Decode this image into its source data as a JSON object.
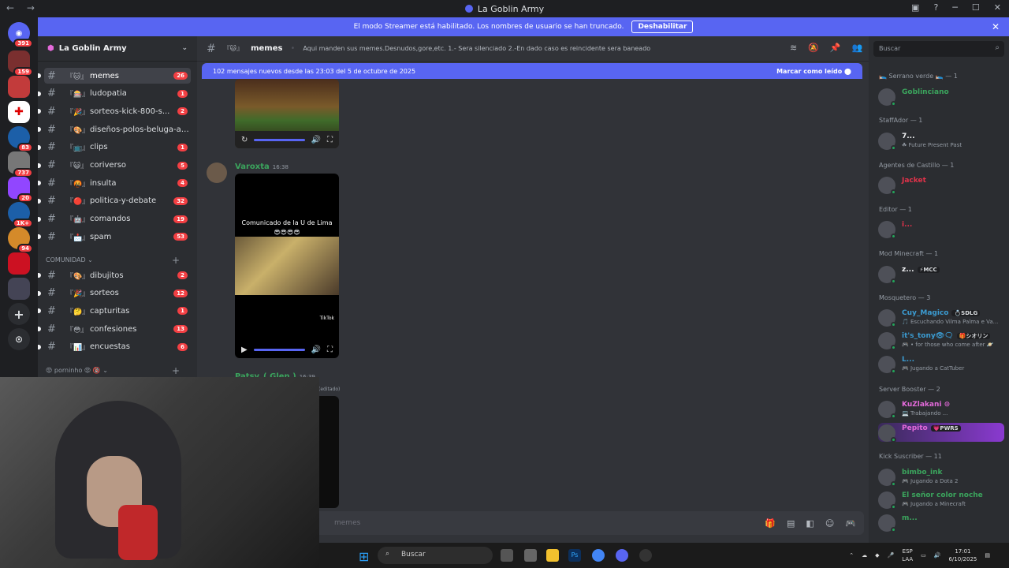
{
  "window": {
    "title": "La Goblin Army",
    "nav_back": "←",
    "nav_fwd": "→"
  },
  "guilds": [
    {
      "label": "391",
      "color": "#e3324a"
    },
    {
      "label": "159",
      "color": "#7a2f2f"
    },
    {
      "label": "",
      "color": "#d44"
    },
    {
      "label": "",
      "color": "#ff3b3b"
    },
    {
      "label": "83",
      "color": "#1c5fa8"
    },
    {
      "label": "737",
      "color": "#777"
    },
    {
      "label": "20",
      "color": "#9146ff"
    },
    {
      "label": "1K+",
      "color": "#1c5fa8"
    },
    {
      "label": "94",
      "color": "#d48a2a"
    },
    {
      "label": "",
      "color": "#c12"
    },
    {
      "label": "",
      "color": "#445"
    }
  ],
  "banner": {
    "text": "El modo Streamer está habilitado. Los nombres de usuario se han truncado.",
    "button": "Deshabilitar",
    "close": "✕"
  },
  "server": {
    "name": "La Goblin Army",
    "caret": "⌄"
  },
  "channels": [
    {
      "emoji": "『🐱』",
      "name": "memes",
      "count": "26",
      "active": true
    },
    {
      "emoji": "『🎰』",
      "name": "ludopatia",
      "count": "1"
    },
    {
      "emoji": "『🎉』",
      "name": "sorteos-kick-800-s...",
      "count": "2"
    },
    {
      "emoji": "『🎨』",
      "name": "diseños-polos-beluga-ar...",
      "count": ""
    },
    {
      "emoji": "『📺』",
      "name": "clips",
      "count": "1"
    },
    {
      "emoji": "『😺』",
      "name": "coriverso",
      "count": "5"
    },
    {
      "emoji": "『🤬』",
      "name": "insulta",
      "count": "4"
    },
    {
      "emoji": "『🔴』",
      "name": "politica-y-debate",
      "count": "32"
    },
    {
      "emoji": "『🤖』",
      "name": "comandos",
      "count": "19"
    },
    {
      "emoji": "『📩』",
      "name": "spam",
      "count": "53"
    }
  ],
  "category_comunidad": {
    "label": "COMUNIDAD",
    "plus": "+"
  },
  "channels2": [
    {
      "emoji": "『🎨』",
      "name": "dibujitos",
      "count": "2"
    },
    {
      "emoji": "『🎉』",
      "name": "sorteos",
      "count": "12"
    },
    {
      "emoji": "『🤔』",
      "name": "capturitas",
      "count": "1"
    },
    {
      "emoji": "『😳』",
      "name": "confesiones",
      "count": "13"
    },
    {
      "emoji": "『📊』",
      "name": "encuestas",
      "count": "6"
    }
  ],
  "category_porninho": {
    "label": "😡 porninho 😡 🔞",
    "plus": "+"
  },
  "chat": {
    "channel": "memes",
    "emoji": "『🐱』",
    "topic": "Aqui manden sus memes.Desnudos,gore,etc. 1.- Sera silenciado 2.-En dado caso es reincidente sera baneado",
    "new_messages": "102 mensajes nuevos desde las 23:03 del 5 de octubre de 2025",
    "mark_read": "Marcar como leído",
    "message2_author": "Varoxta",
    "message2_time": "16:38",
    "video_caption": "Comunicado de la U de Lima",
    "video_emojis": "😎😎😎😎",
    "tiktok": "TikTok",
    "message3_author": "Patsy_( Glen )",
    "message3_time": "16:39",
    "edited": "(editado)",
    "input_placeholder": "memes",
    "search_placeholder": "Buscar"
  },
  "members": {
    "groups": [
      {
        "label": "🛌 Serrano verde 🛌 — 1"
      },
      {
        "label": "StaffAdor — 1"
      },
      {
        "label": "Agentes de Castillo — 1"
      },
      {
        "label": "Editor — 1"
      },
      {
        "label": "Mod Minecraft — 1"
      },
      {
        "label": "Mosquetero — 3"
      },
      {
        "label": "Server Booster — 2"
      },
      {
        "label": "Kick Suscriber — 11"
      }
    ],
    "list": [
      {
        "name": "Goblinciano",
        "activity": "",
        "color": "#3ba55d"
      },
      {
        "name": "7...",
        "activity": "☘ Future Present Past",
        "color": "#f2f3f5"
      },
      {
        "name": "Jacket",
        "activity": "",
        "color": "#e3324a"
      },
      {
        "name": "i...",
        "activity": "",
        "color": "#e3324a"
      },
      {
        "name": "z...",
        "activity": "",
        "tag": "⚡MCC",
        "color": "#f2f3f5"
      },
      {
        "name": "Cuy_Magico",
        "activity": "🎵 Escuchando Vilma Palma e Va...",
        "tag": "💍SDLG",
        "color": "#3b9bd1"
      },
      {
        "name": "it's_tony👁🗨",
        "activity": "🎮 • for those who come after 🪐",
        "tag": "🎁シオリン",
        "color": "#3b9bd1"
      },
      {
        "name": "L...",
        "activity": "🎮 Jugando a CatTuber",
        "color": "#3b9bd1"
      },
      {
        "name": "KuZlakani ⊙",
        "activity": "💻 Trabajando ...",
        "color": "#e46adb"
      },
      {
        "name": "Pepito",
        "activity": "",
        "tag": "💗PWRS",
        "color": "#e46adb"
      },
      {
        "name": "bimbo_ink",
        "activity": "🎮 Jugando a Dota 2",
        "color": "#3ba55d"
      },
      {
        "name": "El señor color noche",
        "activity": "🎮 Jugando a Minecraft",
        "color": "#3ba55d"
      },
      {
        "name": "m...",
        "activity": "",
        "color": "#3ba55d"
      }
    ]
  },
  "taskbar": {
    "search": "Buscar",
    "lang": "ESP",
    "lang2": "LAA",
    "time": "17:01",
    "date": "6/10/2025"
  }
}
